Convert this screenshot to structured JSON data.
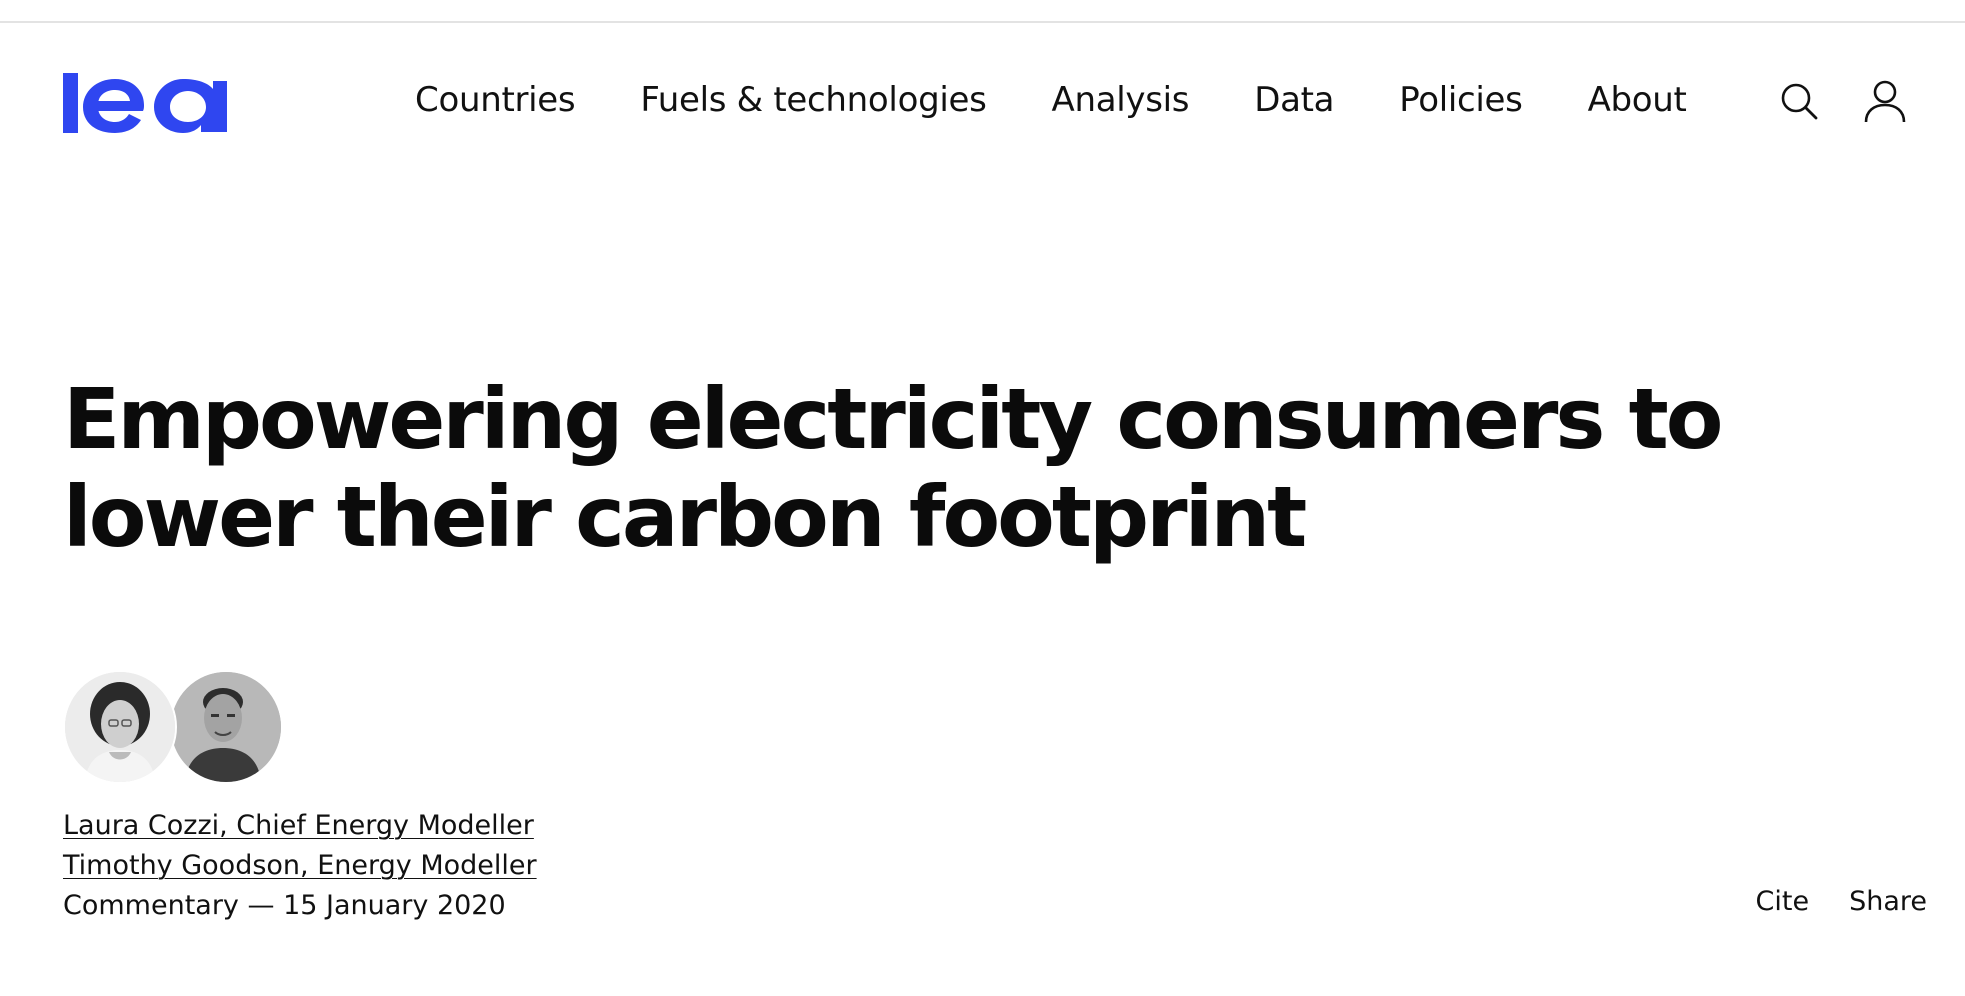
{
  "site": {
    "logo_text": "iea",
    "brand_color": "#2f46f0"
  },
  "nav": {
    "items": [
      {
        "label": "Countries"
      },
      {
        "label": "Fuels & technologies"
      },
      {
        "label": "Analysis"
      },
      {
        "label": "Data"
      },
      {
        "label": "Policies"
      },
      {
        "label": "About"
      }
    ],
    "search_icon": "search-icon",
    "user_icon": "user-icon"
  },
  "article": {
    "title_line1": "Empowering electricity consumers to",
    "title_line2": "lower their carbon footprint",
    "authors": [
      {
        "label": "Laura Cozzi, Chief Energy Modeller"
      },
      {
        "label": "Timothy Goodson, Energy Modeller"
      }
    ],
    "meta": "Commentary — 15 January 2020",
    "actions": {
      "cite": "Cite",
      "share": "Share"
    }
  }
}
